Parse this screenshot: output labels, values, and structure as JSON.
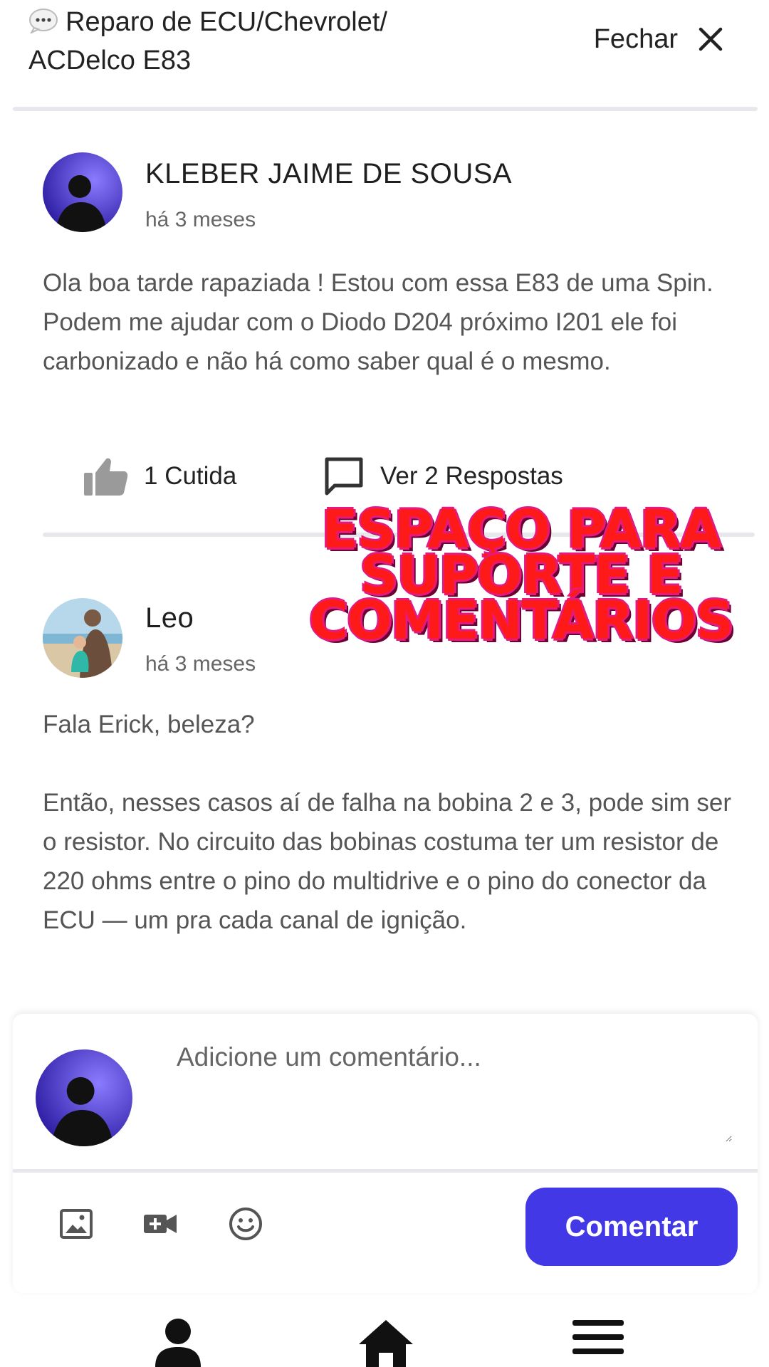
{
  "header": {
    "title": "Reparo de ECU/Chevrolet/ ACDelco E83",
    "close_label": "Fechar"
  },
  "posts": [
    {
      "author": "KLEBER JAIME DE SOUSA",
      "time": "há 3 meses",
      "body": "Ola boa tarde rapaziada ! Estou com essa E83 de uma Spin. Podem me ajudar com o Diodo D204 próximo I201 ele foi carbonizado e não há como saber qual é o mesmo.",
      "likes_label": "1 Cutida",
      "replies_label": "Ver 2 Respostas"
    },
    {
      "author": "Leo",
      "time": "há 3 meses",
      "body_lines": [
        "Fala Erick, beleza?",
        "Então, nesses casos aí de falha na bobina 2 e 3, pode sim ser o resistor. No circuito das bobinas costuma ter um resistor de 220 ohms entre o pino do multidrive e o pino do conector da ECU — um pra cada canal de ignição."
      ]
    }
  ],
  "overlay": {
    "line1": "ESPAÇO PARA",
    "line2": "SUPORTE E",
    "line3": "COMENTÁRIOS"
  },
  "composer": {
    "placeholder": "Adicione um comentário...",
    "submit_label": "Comentar"
  },
  "colors": {
    "accent": "#4338e6",
    "overlay_text": "#ff1a1a"
  },
  "icons": [
    "chat-bubble-icon",
    "close-icon",
    "thumbs-up-icon",
    "comment-icon",
    "image-icon",
    "video-icon",
    "emoji-icon",
    "profile-icon",
    "home-icon",
    "menu-icon"
  ]
}
